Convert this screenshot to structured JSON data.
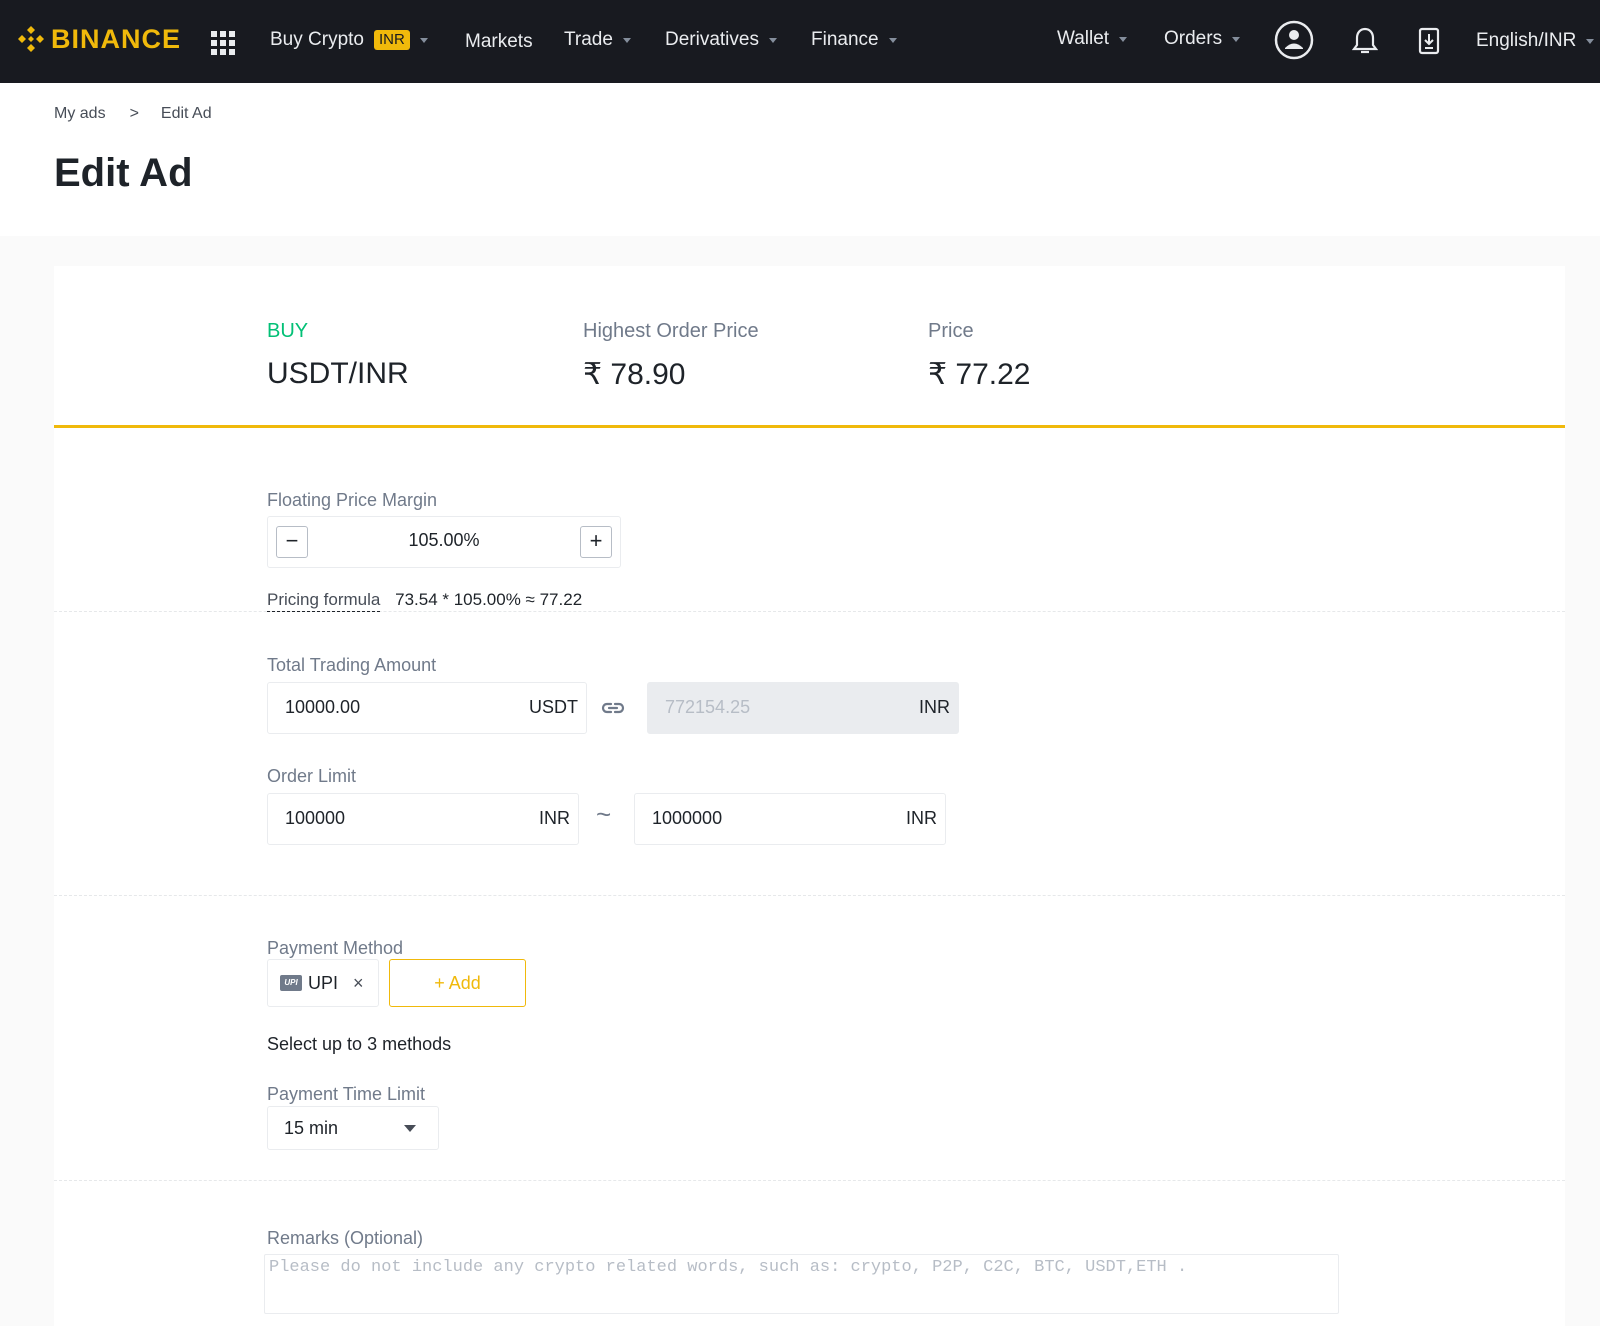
{
  "nav": {
    "brand": "BINANCE",
    "buy_crypto": "Buy Crypto",
    "buy_crypto_badge": "INR",
    "markets": "Markets",
    "trade": "Trade",
    "derivatives": "Derivatives",
    "finance": "Finance",
    "wallet": "Wallet",
    "orders": "Orders",
    "language": "English/INR",
    "icons": [
      "grid-menu-icon",
      "profile-icon",
      "bell-icon",
      "download-icon"
    ]
  },
  "breadcrumb": {
    "parent": "My ads",
    "separator": ">",
    "current": "Edit Ad"
  },
  "page_title": "Edit Ad",
  "summary": {
    "side": "BUY",
    "pair": "USDT/INR",
    "highest_label": "Highest Order Price",
    "highest_value": "₹ 78.90",
    "price_label": "Price",
    "price_value": "₹ 77.22"
  },
  "pricing": {
    "label": "Floating Price Margin",
    "minus": "−",
    "value": "105.00%",
    "plus": "+",
    "formula_link": "Pricing formula",
    "formula_text": "73.54 * 105.00% ≈ 77.22"
  },
  "amount": {
    "label": "Total Trading Amount",
    "crypto_value": "10000.00",
    "crypto_unit": "USDT",
    "fiat_value": "772154.25",
    "fiat_unit": "INR",
    "limit_label": "Order Limit",
    "min_value": "100000",
    "min_unit": "INR",
    "range_sep": "~",
    "max_value": "1000000",
    "max_unit": "INR"
  },
  "payment": {
    "label": "Payment Method",
    "methods": [
      {
        "logo": "UPI",
        "name": "UPI",
        "remove": "×"
      }
    ],
    "add_label": "+ Add",
    "hint": "Select up to 3 methods",
    "time_label": "Payment Time Limit",
    "time_value": "15 min"
  },
  "remarks": {
    "label": "Remarks (Optional)",
    "placeholder": "Please do not include any crypto related words, such as: crypto, P2P, C2C, BTC, USDT,ETH ."
  },
  "colors": {
    "brand": "#f0b90b",
    "nav_bg": "#181a20",
    "buy": "#02c076"
  }
}
